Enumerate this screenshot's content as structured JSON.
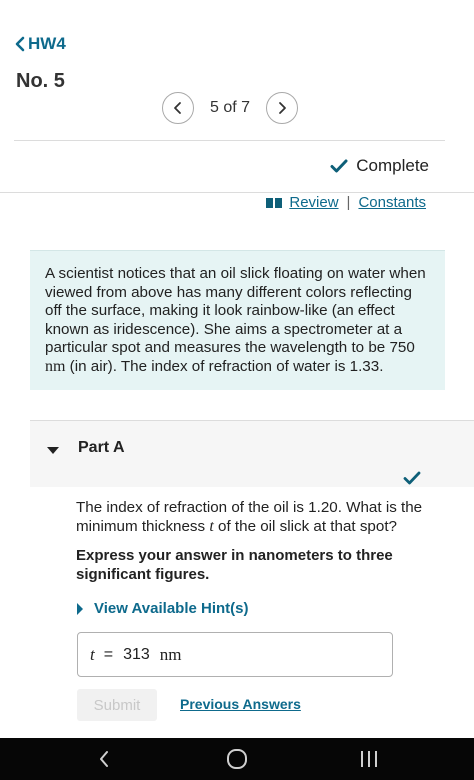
{
  "header": {
    "back_label": "HW4",
    "problem_title": "No. 5"
  },
  "pager": {
    "label": "5 of 7"
  },
  "status": {
    "label": "Complete"
  },
  "links": {
    "review": "Review",
    "separator": "|",
    "constants": "Constants"
  },
  "problem": {
    "text_1": "A scientist notices that an oil slick floating on water when viewed from above has many different colors reflecting off the surface, making it look rainbow-like (an effect known as iridescence). She aims a spectrometer at a particular spot and measures the wavelength to be 750 ",
    "unit": "nm",
    "text_2": " (in air). The index of refraction of water is 1.33."
  },
  "part": {
    "title": "Part A",
    "question_1": "The index of refraction of the oil is 1.20. What is the minimum thickness ",
    "question_var": "t",
    "question_2": " of the oil slick at that spot?",
    "instruction": "Express your answer in nanometers to three significant figures.",
    "hints_label": "View Available Hint(s)",
    "answer": {
      "variable": "t",
      "equals": "=",
      "value": "313",
      "unit": "nm"
    },
    "submit_label": "Submit",
    "previous_answers_label": "Previous Answers"
  },
  "colors": {
    "link": "#0e6a8c",
    "problem_background": "#e6f4f4",
    "check": "#0e5f78"
  }
}
